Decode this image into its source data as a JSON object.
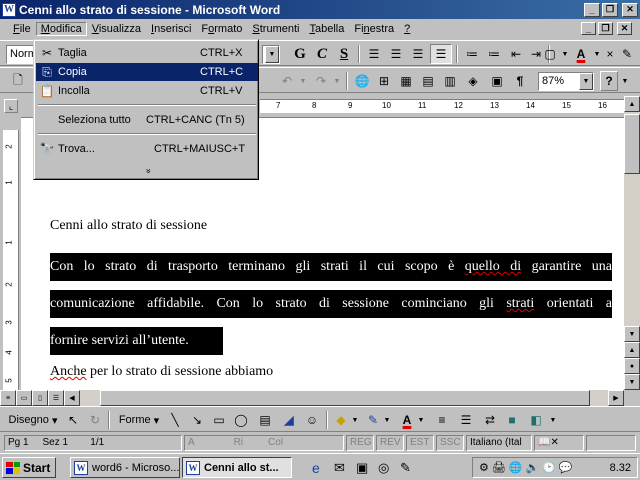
{
  "window": {
    "title": "Cenni allo strato di sessione - Microsoft Word",
    "app_icon": "W",
    "min_glyph": "_",
    "max_glyph": "❐",
    "close_glyph": "✕"
  },
  "menubar": {
    "items": [
      {
        "pre": "",
        "u": "F",
        "post": "ile"
      },
      {
        "pre": "",
        "u": "M",
        "post": "odifica"
      },
      {
        "pre": "",
        "u": "V",
        "post": "isualizza"
      },
      {
        "pre": "",
        "u": "I",
        "post": "nserisci"
      },
      {
        "pre": "F",
        "u": "o",
        "post": "rmato"
      },
      {
        "pre": "",
        "u": "S",
        "post": "trumenti"
      },
      {
        "pre": "",
        "u": "T",
        "post": "abella"
      },
      {
        "pre": "Fi",
        "u": "n",
        "post": "estra"
      },
      {
        "pre": "",
        "u": "?",
        "post": ""
      }
    ]
  },
  "edit_menu": {
    "items": [
      {
        "icon": "✂",
        "label": "Taglia",
        "shortcut": "CTRL+X"
      },
      {
        "icon": "⎘",
        "label": "Copia",
        "shortcut": "CTRL+C",
        "highlighted": true
      },
      {
        "icon": "📋",
        "label": "Incolla",
        "shortcut": "CTRL+V"
      },
      {
        "icon": "",
        "label": "Seleziona tutto",
        "shortcut": "CTRL+CANC (Tn 5)"
      },
      {
        "icon": "🔭",
        "label": "Trova...",
        "shortcut": "CTRL+MAIUSC+T"
      }
    ],
    "more": "»"
  },
  "format_toolbar": {
    "style_value": "Norm",
    "bold": "G",
    "italic": "C",
    "underline": "S"
  },
  "standard_toolbar": {
    "zoom_value": "87%",
    "help": "?"
  },
  "ruler": {
    "numbers": [
      "7",
      "8",
      "9",
      "10",
      "11",
      "12",
      "13",
      "14",
      "15",
      "16"
    ]
  },
  "vruler": {
    "numbers": [
      "2",
      "1",
      "1",
      "2",
      "3",
      "4",
      "5"
    ]
  },
  "document": {
    "heading": "Cenni allo strato di sessione",
    "line1": [
      "Con lo strato di trasporto terminano gli strati il cui scopo è ",
      "quello di",
      " garantire una"
    ],
    "line2": [
      "comunicazione affidabile. Con lo strato di sessione cominciano gli ",
      "strati",
      " orientati a"
    ],
    "line3": "fornire servizi all’utente.",
    "line4": [
      "Anche",
      " per lo strato di sessione abbiamo"
    ]
  },
  "draw_toolbar": {
    "disegno": "Disegno",
    "forme": "Forme"
  },
  "statusbar": {
    "page": "Pg 1",
    "section": "Sez 1",
    "pages": "1/1",
    "at": "A",
    "line": "Ri",
    "col": "Col",
    "reg": "REG",
    "rev": "REV",
    "est": "EST",
    "ssc": "SSC",
    "language": "Italiano (Ital"
  },
  "taskbar": {
    "start": "Start",
    "tasks": [
      "word6 - Microso...",
      "Cenni allo st..."
    ],
    "clock": "8.32"
  }
}
